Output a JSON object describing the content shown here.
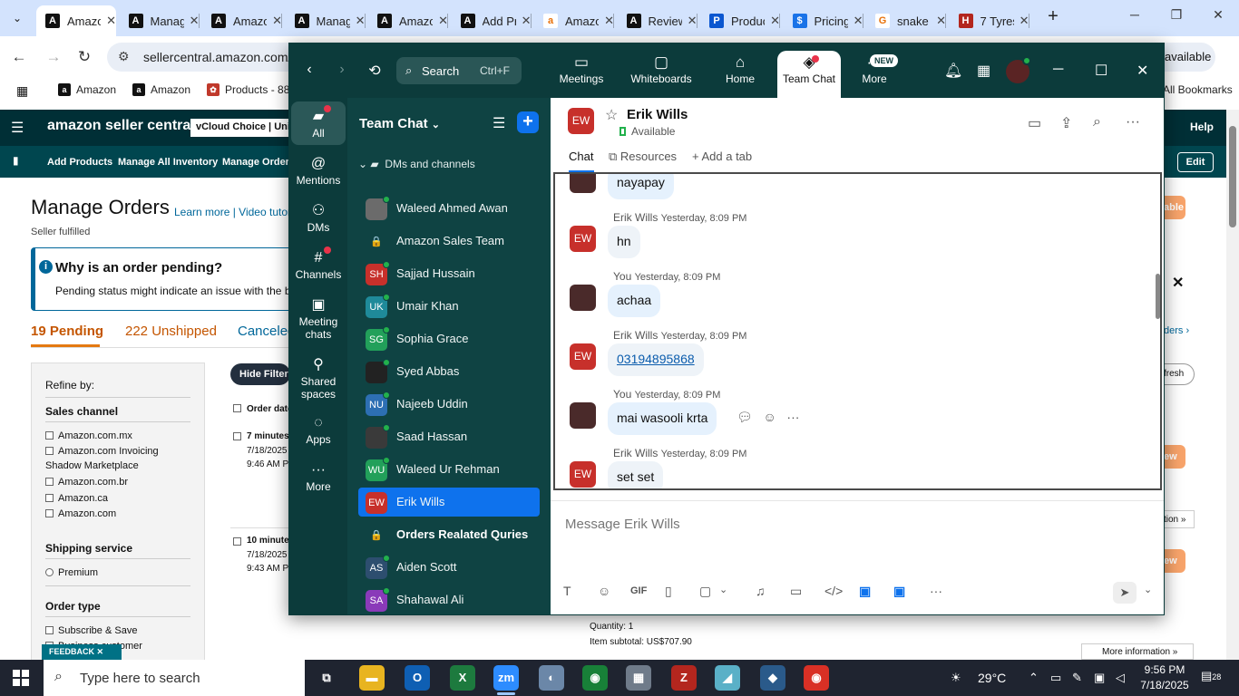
{
  "browser": {
    "tabs": [
      {
        "title": "Amazon",
        "icon": "A",
        "active": true
      },
      {
        "title": "Manage Orders",
        "icon": "A"
      },
      {
        "title": "Amazon",
        "icon": "A"
      },
      {
        "title": "Manage",
        "icon": "A"
      },
      {
        "title": "Amazon",
        "icon": "A"
      },
      {
        "title": "Add Products",
        "icon": "A"
      },
      {
        "title": "Amazon",
        "icon": "a"
      },
      {
        "title": "Reviews",
        "icon": "A"
      },
      {
        "title": "Products",
        "icon": "P"
      },
      {
        "title": "Pricing",
        "icon": "$"
      },
      {
        "title": "snake",
        "icon": "G"
      },
      {
        "title": "7 Tyres",
        "icon": "H"
      }
    ],
    "url": "sellercentral.amazon.com/",
    "bookmarks": [
      {
        "label": "Amazon"
      },
      {
        "label": "Amazon"
      },
      {
        "label": "Products - 88"
      }
    ],
    "all_bookmarks": "All Bookmarks",
    "available_label": "available"
  },
  "amazon": {
    "logo": "amazon seller central",
    "vcloud": "vCloud Choice | Uni",
    "help": "Help",
    "nav": [
      "Add Products",
      "Manage All Inventory",
      "Manage Orders"
    ],
    "edit": "Edit",
    "page_title": "Manage Orders",
    "learn_more": "Learn more",
    "video_tutorial": "Video tutori",
    "seller_fulfilled": "Seller fulfilled",
    "alert_title": "Why is an order pending?",
    "alert_text": "Pending status might indicate an issue with the buy",
    "order_tabs": [
      "19 Pending",
      "222 Unshipped",
      "Canceled"
    ],
    "refine_by": "Refine by:",
    "sales_channel": "Sales channel",
    "channels": [
      "Amazon.com.mx",
      "Amazon.com Invoicing",
      "Shadow Marketplace",
      "Amazon.com.br",
      "Amazon.ca",
      "Amazon.com"
    ],
    "shipping_service": "Shipping service",
    "premium": "Premium",
    "order_type": "Order type",
    "subscribe_save": "Subscribe & Save",
    "business_customer": "Business customer",
    "hide_filters": "Hide Filters",
    "order_date_header": "Order date",
    "orders": [
      {
        "age": "7 minutes",
        "date": "7/18/2025",
        "time": "9:46 AM PDT"
      },
      {
        "age": "10 minutes",
        "date": "7/18/2025",
        "time": "9:43 AM PDT"
      }
    ],
    "right_labels": {
      "enable": "able",
      "refresh": "fresh",
      "orders_link": "ders ›",
      "view1": "ew",
      "option": "tion »",
      "view2": "ew"
    },
    "quantity": "Quantity: 1",
    "item_subtotal": "Item subtotal: US$707.90",
    "more_info": "More information »",
    "feedback": "FEEDBACK ✕"
  },
  "zoom": {
    "search_label": "Search",
    "search_shortcut": "Ctrl+F",
    "top_tabs": [
      {
        "label": "Meetings",
        "icon": "video-icon"
      },
      {
        "label": "Whiteboards",
        "icon": "whiteboard-icon"
      },
      {
        "label": "Home",
        "icon": "home-icon"
      },
      {
        "label": "Team Chat",
        "icon": "chat-icon",
        "active": true
      },
      {
        "label": "More",
        "icon": "more-icon"
      }
    ],
    "new_badge": "NEW",
    "rail": [
      {
        "label": "All",
        "icon": "chat-bubble-icon"
      },
      {
        "label": "Mentions",
        "icon": "at-icon"
      },
      {
        "label": "DMs",
        "icon": "people-icon"
      },
      {
        "label": "Channels",
        "icon": "hash-icon"
      },
      {
        "label": "Meeting chats",
        "icon": "calendar-chat-icon"
      },
      {
        "label": "Shared spaces",
        "icon": "share-icon"
      },
      {
        "label": "Apps",
        "icon": "apps-icon"
      },
      {
        "label": "More",
        "icon": "ellipsis-icon"
      }
    ],
    "list_title": "Team Chat",
    "group_label": "DMs and channels",
    "contacts": [
      {
        "name": "Waleed Ahmed Awan",
        "initials": "",
        "color": "#6b6b6b",
        "status": true
      },
      {
        "name": "Amazon Sales Team",
        "initials": "🔒",
        "color": "#2f5656",
        "locked": true
      },
      {
        "name": "Sajjad Hussain",
        "initials": "SH",
        "color": "#c7302b",
        "status": true
      },
      {
        "name": "Umair Khan",
        "initials": "UK",
        "color": "#1f8a9a",
        "status": true
      },
      {
        "name": "Sophia Grace",
        "initials": "SG",
        "color": "#22a05a",
        "status": true
      },
      {
        "name": "Syed Abbas",
        "initials": "",
        "color": "#222222",
        "status": true
      },
      {
        "name": "Najeeb Uddin",
        "initials": "NU",
        "color": "#2d6fb3",
        "status": true
      },
      {
        "name": "Saad Hassan",
        "initials": "",
        "color": "#3a3a3a",
        "status": true
      },
      {
        "name": "Waleed Ur Rehman",
        "initials": "WU",
        "color": "#22a05a",
        "status": true
      },
      {
        "name": "Erik Wills",
        "initials": "EW",
        "color": "#c7302b",
        "active": true
      },
      {
        "name": "Orders Realated Quries",
        "initials": "🔒",
        "color": "#2f5656",
        "locked": true,
        "bold": true
      },
      {
        "name": "Aiden Scott",
        "initials": "AS",
        "color": "#2d4e6f",
        "status": true
      },
      {
        "name": "Shahawal Ali",
        "initials": "SA",
        "color": "#8a3ab9",
        "status": true
      }
    ],
    "chat": {
      "initials": "EW",
      "name": "Erik Wills",
      "status": "Available",
      "tabs": [
        "Chat",
        "Resources",
        "+ Add a tab"
      ],
      "messages": [
        {
          "sender": "You",
          "time": "",
          "text": "nayapay",
          "mine": true,
          "partial": true
        },
        {
          "sender": "Erik Wills",
          "time": "Yesterday, 8:09 PM",
          "text": "hn",
          "mine": false
        },
        {
          "sender": "You",
          "time": "Yesterday, 8:09 PM",
          "text": "achaa",
          "mine": true
        },
        {
          "sender": "Erik Wills",
          "time": "Yesterday, 8:09 PM",
          "text": "03194895868",
          "mine": false,
          "link": true
        },
        {
          "sender": "You",
          "time": "Yesterday, 8:09 PM",
          "text": "mai wasooli krta",
          "mine": true,
          "actions": true
        },
        {
          "sender": "Erik Wills",
          "time": "Yesterday, 8:09 PM",
          "text": "set set",
          "mine": false
        }
      ],
      "compose_placeholder": "Message Erik Wills",
      "gif": "GIF"
    }
  },
  "taskbar": {
    "search_placeholder": "Type here to search",
    "temperature": "29°C",
    "time": "9:56 PM",
    "date": "7/18/2025",
    "notifications": "28"
  }
}
